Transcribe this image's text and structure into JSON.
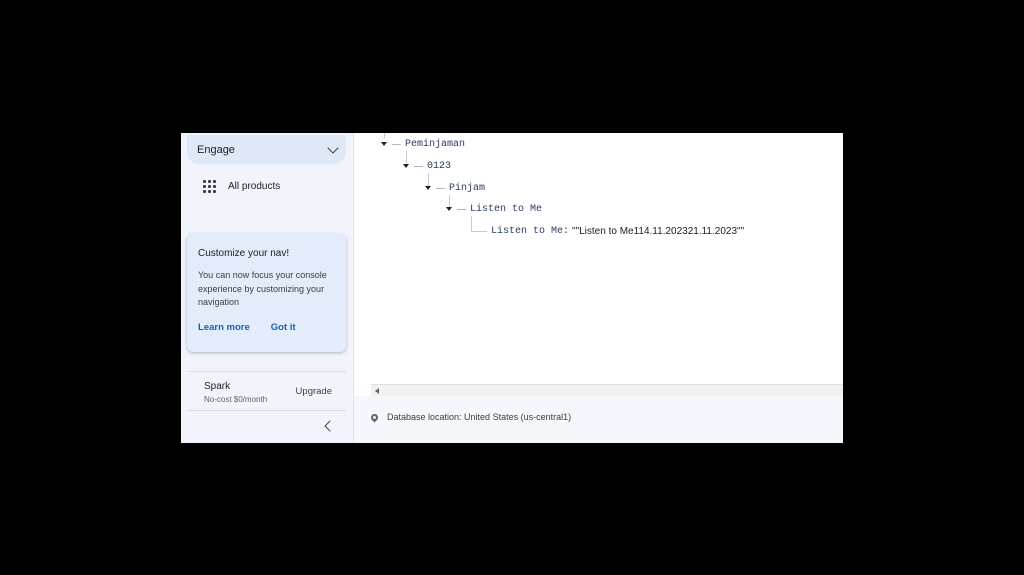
{
  "sidebar": {
    "engage_label": "Engage",
    "all_products_label": "All products",
    "nav_card": {
      "title": "Customize your nav!",
      "body": "You can now focus your console experience by customizing your navigation",
      "learn_more": "Learn more",
      "got_it": "Got it"
    },
    "plan": {
      "name": "Spark",
      "price": "No-cost $0/month",
      "upgrade": "Upgrade"
    }
  },
  "tree": {
    "nodes": [
      "Peminjaman",
      "0123",
      "Pinjam",
      "Listen to Me"
    ],
    "leaf_key": "Listen to Me:",
    "leaf_value": "\"\"Listen to Me114.11.202321.11.2023\"\""
  },
  "footer": {
    "database_location": "Database location: United States (us-central1)"
  }
}
